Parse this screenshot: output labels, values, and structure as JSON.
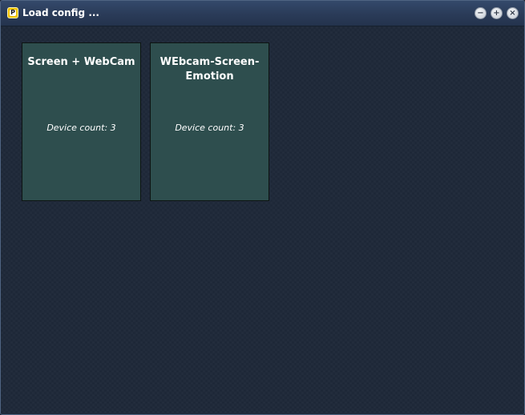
{
  "window": {
    "title": "Load config ...",
    "app_icon": "app-logo-icon",
    "app_icon_letter": "P",
    "controls": {
      "minimize_glyph": "−",
      "maximize_glyph": "+",
      "close_glyph": "×"
    }
  },
  "configs": [
    {
      "name": "Screen + WebCam",
      "device_count_label": "Device count: 3"
    },
    {
      "name": "WEbcam-Screen-Emotion",
      "device_count_label": "Device count: 3"
    }
  ],
  "colors": {
    "titlebar": "#2a3b58",
    "background": "#1e2838",
    "card": "#2e4e4e",
    "text": "#ffffff"
  }
}
